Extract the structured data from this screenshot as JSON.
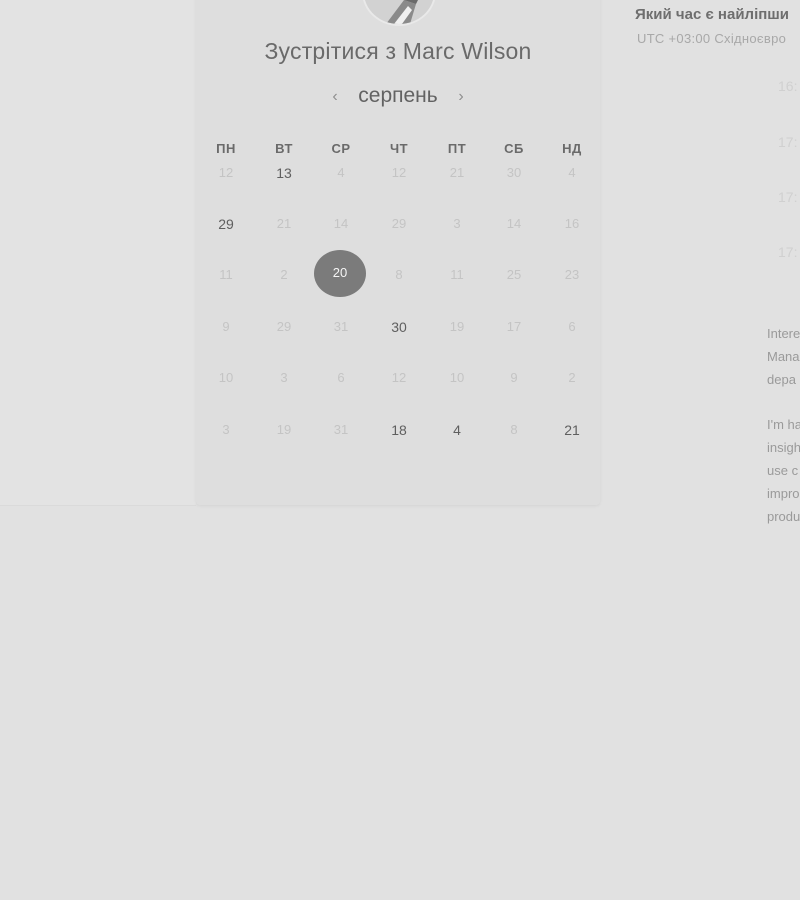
{
  "meeting": {
    "title": "Зустрітися з Marc Wilson"
  },
  "calendar": {
    "month": "серпень",
    "prev_icon": "chevron-left-icon",
    "next_icon": "chevron-right-icon",
    "weekdays": [
      "ПН",
      "ВТ",
      "СР",
      "ЧТ",
      "ПТ",
      "СБ",
      "НД"
    ],
    "weeks": [
      [
        "12",
        "13",
        "4",
        "12",
        "21",
        "30",
        "4"
      ],
      [
        "29",
        "21",
        "14",
        "29",
        "3",
        "14",
        "16"
      ],
      [
        "11",
        "2",
        "20",
        "8",
        "11",
        "25",
        "23"
      ],
      [
        "9",
        "29",
        "31",
        "30",
        "19",
        "17",
        "6"
      ],
      [
        "10",
        "3",
        "6",
        "12",
        "10",
        "9",
        "2"
      ],
      [
        "3",
        "19",
        "31",
        "18",
        "4",
        "8",
        "21"
      ]
    ],
    "available": [
      [
        0,
        1
      ],
      [
        1,
        0
      ],
      [
        3,
        3
      ],
      [
        5,
        3
      ],
      [
        5,
        4
      ],
      [
        5,
        6
      ]
    ],
    "selected": [
      2,
      2
    ],
    "selected_color": "#7b7b7b"
  },
  "time_panel": {
    "title": "Який час є найліпши",
    "timezone": "UTC +03:00 Східноєвро",
    "slots": [
      "16:",
      "17:",
      "17:",
      "17:"
    ]
  },
  "description": {
    "lines_1": [
      "Intere",
      "Mana",
      "depa"
    ],
    "lines_2": [
      "I'm ha",
      "insigh",
      "use c",
      "impro",
      "produ"
    ]
  }
}
